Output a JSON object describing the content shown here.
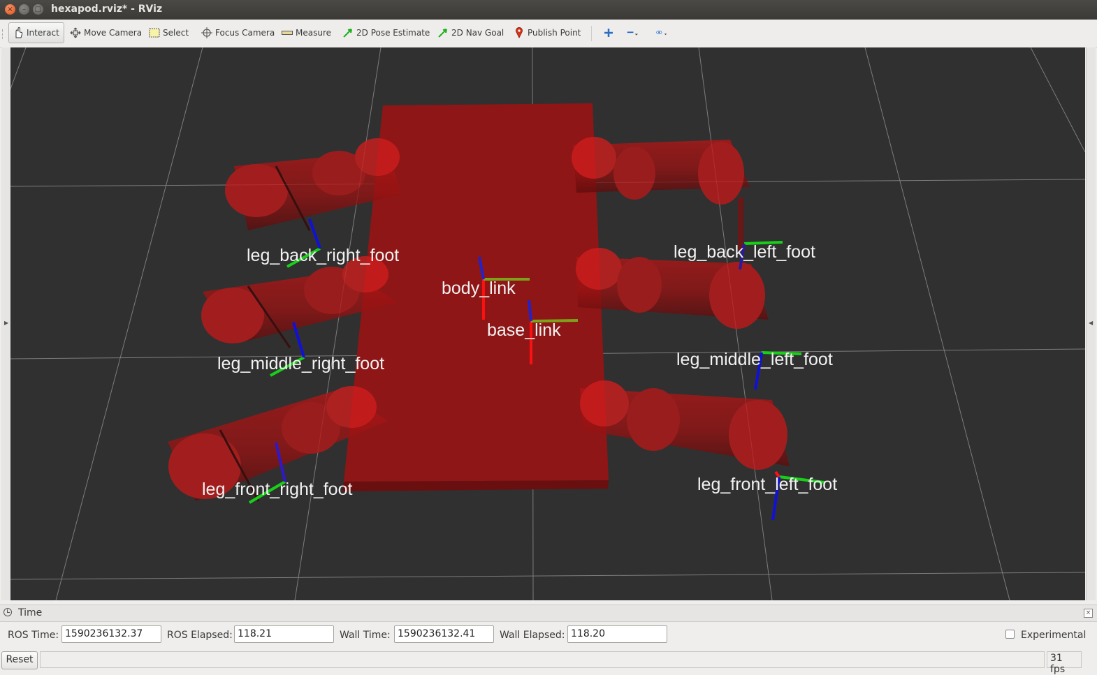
{
  "window": {
    "title": "hexapod.rviz* - RViz",
    "close_glyph": "×",
    "minimize_glyph": "–",
    "maximize_glyph": "□"
  },
  "toolbar": {
    "tools": [
      {
        "label": "Interact",
        "icon": "hand-icon",
        "active": true
      },
      {
        "label": "Move Camera",
        "icon": "move-camera-icon"
      },
      {
        "label": "Select",
        "icon": "select-icon"
      },
      {
        "label": "Focus Camera",
        "icon": "focus-camera-icon"
      },
      {
        "label": "Measure",
        "icon": "ruler-icon"
      },
      {
        "label": "2D Pose Estimate",
        "icon": "green-arrow-icon"
      },
      {
        "label": "2D Nav Goal",
        "icon": "green-arrow-icon"
      },
      {
        "label": "Publish Point",
        "icon": "map-pin-icon"
      }
    ],
    "extra": [
      {
        "name": "add-tool-icon"
      },
      {
        "name": "remove-tool-icon"
      },
      {
        "name": "view-options-icon"
      }
    ]
  },
  "scene": {
    "labels": {
      "body_link": "body_link",
      "base_link": "base_link",
      "leg_back_right_foot": "leg_back_right_foot",
      "leg_middle_right_foot": "leg_middle_right_foot",
      "leg_front_right_foot": "leg_front_right_foot",
      "leg_back_left_foot": "leg_back_left_foot",
      "leg_middle_left_foot": "leg_middle_left_foot",
      "leg_front_left_foot": "leg_front_left_foot"
    },
    "colors": {
      "background": "#303030",
      "grid": "#8a8a8a",
      "body": "#8e1616",
      "leg": "#c41a1a",
      "axis_x": "#ff0000",
      "axis_y": "#18d018",
      "axis_z": "#1010d8"
    }
  },
  "time_panel": {
    "title": "Time",
    "close_glyph": "×",
    "ros_time_label": "ROS Time:",
    "ros_time": "1590236132.37",
    "ros_elapsed_label": "ROS Elapsed:",
    "ros_elapsed": "118.21",
    "wall_time_label": "Wall Time:",
    "wall_time": "1590236132.41",
    "wall_elapsed_label": "Wall Elapsed:",
    "wall_elapsed": "118.20",
    "experimental_label": "Experimental",
    "experimental_checked": false
  },
  "status": {
    "reset_label": "Reset",
    "fps": "31 fps"
  }
}
